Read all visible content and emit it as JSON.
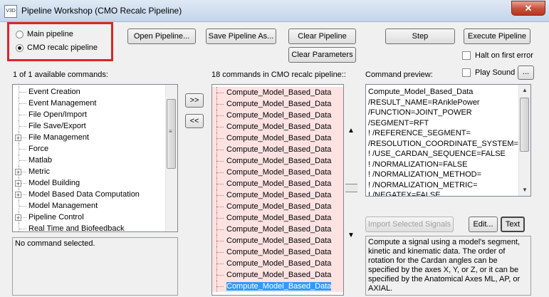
{
  "window": {
    "title": "Pipeline Workshop (CMO Recalc Pipeline)",
    "app_icon": "V3D",
    "close_glyph": "✕"
  },
  "pipeline_select": {
    "options": [
      {
        "label": "Main pipeline",
        "selected": false
      },
      {
        "label": "CMO recalc pipeline",
        "selected": true
      }
    ]
  },
  "toolbar": {
    "open": "Open Pipeline...",
    "save_as": "Save Pipeline As...",
    "clear_pipeline": "Clear Pipeline",
    "clear_parameters": "Clear Parameters",
    "step": "Step",
    "execute": "Execute Pipeline",
    "halt_on_error": "Halt on first error",
    "play_sound": "Play Sound",
    "sound_browse": "..."
  },
  "available": {
    "header": "1 of 1 available commands:",
    "items": [
      {
        "label": "Event Creation",
        "expandable": false
      },
      {
        "label": "Event Management",
        "expandable": false
      },
      {
        "label": "File Open/Import",
        "expandable": false
      },
      {
        "label": "File Save/Export",
        "expandable": false
      },
      {
        "label": "File Management",
        "expandable": true
      },
      {
        "label": "Force",
        "expandable": false
      },
      {
        "label": "Matlab",
        "expandable": false
      },
      {
        "label": "Metric",
        "expandable": true
      },
      {
        "label": "Model Building",
        "expandable": true
      },
      {
        "label": "Model Based Data Computation",
        "expandable": true
      },
      {
        "label": "Model Management",
        "expandable": false
      },
      {
        "label": "Pipeline Control",
        "expandable": true
      },
      {
        "label": "Real Time and Biofeedback",
        "expandable": false
      }
    ],
    "description": "No command selected."
  },
  "transfer": {
    "add": ">>",
    "remove": "<<"
  },
  "pipeline": {
    "header": "18 commands in CMO recalc pipeline::",
    "items": [
      "Compute_Model_Based_Data",
      "Compute_Model_Based_Data",
      "Compute_Model_Based_Data",
      "Compute_Model_Based_Data",
      "Compute_Model_Based_Data",
      "Compute_Model_Based_Data",
      "Compute_Model_Based_Data",
      "Compute_Model_Based_Data",
      "Compute_Model_Based_Data",
      "Compute_Model_Based_Data",
      "Compute_Model_Based_Data",
      "Compute_Model_Based_Data",
      "Compute_Model_Based_Data",
      "Compute_Model_Based_Data",
      "Compute_Model_Based_Data",
      "Compute_Model_Based_Data",
      "Compute_Model_Based_Data",
      "Compute_Model_Based_Data"
    ],
    "selected_index": 17
  },
  "preview": {
    "header": "Command preview:",
    "lines": [
      "Compute_Model_Based_Data",
      "/RESULT_NAME=RAnklePower",
      "/FUNCTION=JOINT_POWER",
      "/SEGMENT=RFT",
      "! /REFERENCE_SEGMENT=",
      "/RESOLUTION_COORDINATE_SYSTEM=RSK",
      "! /USE_CARDAN_SEQUENCE=FALSE",
      "! /NORMALIZATION=FALSE",
      "! /NORMALIZATION_METHOD=",
      "! /NORMALIZATION_METRIC=",
      "! /NEGATEX=FALSE"
    ],
    "import_signals": "Import Selected Signals",
    "edit": "Edit...",
    "text": "Text",
    "description": "Compute a signal using a model's segment, kinetic and kinematic data. The order of rotation for the Cardan angles can be specified by the axes X, Y, or Z, or it can be specified by the Anatomical Axes ML, AP, or AXIAL."
  },
  "colors": {
    "highlight": "#d9262b",
    "selection": "#3399ff",
    "pipeline_row": "#fde2e2"
  }
}
